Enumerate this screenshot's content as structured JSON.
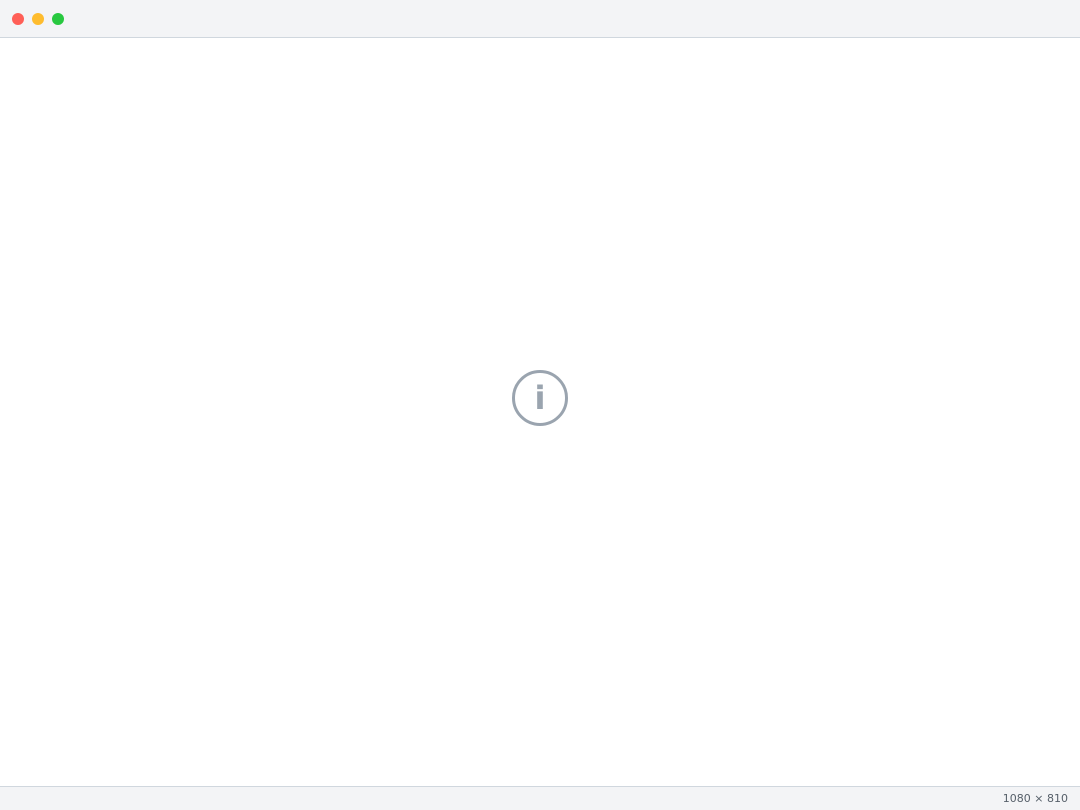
{
  "window": {
    "title": ""
  },
  "main": {
    "icon": "info-icon",
    "heading": "",
    "message": "",
    "glyph": "i"
  },
  "status": {
    "size": "1080 × 810"
  }
}
